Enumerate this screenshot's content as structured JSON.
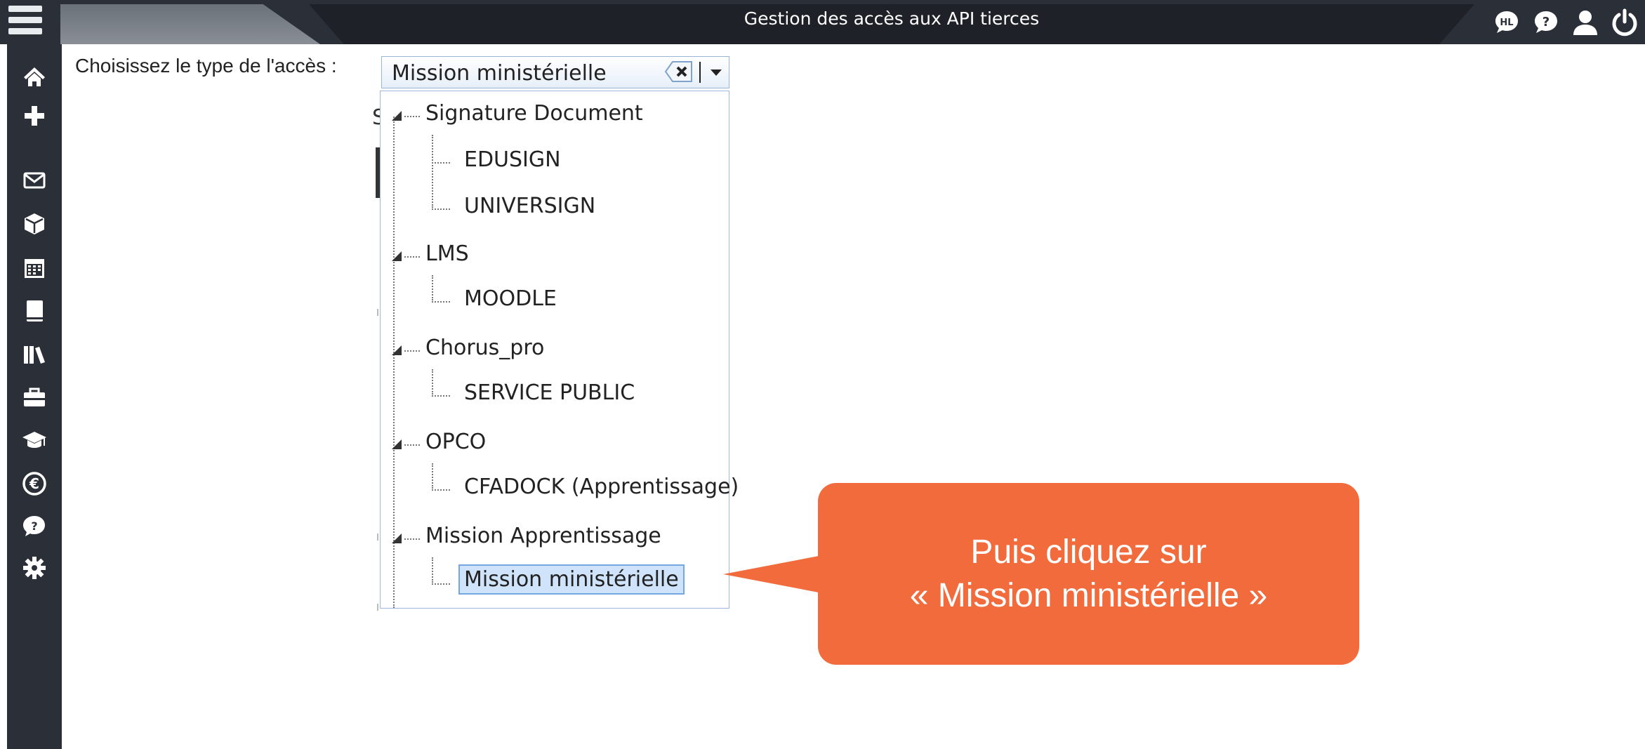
{
  "window": {
    "title": "Gestion des accès aux API tierces"
  },
  "top_icons": [
    "hl-chat-icon",
    "help-chat-icon",
    "user-icon",
    "power-icon"
  ],
  "sidebar": {
    "items": [
      {
        "icon": "home-icon"
      },
      {
        "icon": "plus-icon"
      },
      {
        "icon": "envelope-icon"
      },
      {
        "icon": "cube-icon"
      },
      {
        "icon": "calendar-icon"
      },
      {
        "icon": "book-icon"
      },
      {
        "icon": "library-icon"
      },
      {
        "icon": "briefcase-icon"
      },
      {
        "icon": "graduation-cap-icon"
      },
      {
        "icon": "euro-icon"
      },
      {
        "icon": "help-bubble-icon"
      },
      {
        "icon": "gear-icon"
      }
    ]
  },
  "form": {
    "label": "Choisissez le type de l'accès :",
    "selected_value": "Mission ministérielle",
    "behind_letter": "S"
  },
  "tree": [
    {
      "label": "Signature Document",
      "children": [
        "EDUSIGN",
        "UNIVERSIGN"
      ]
    },
    {
      "label": "LMS",
      "children": [
        "MOODLE"
      ]
    },
    {
      "label": "Chorus_pro",
      "children": [
        "SERVICE PUBLIC"
      ]
    },
    {
      "label": "OPCO",
      "children": [
        "CFADOCK (Apprentissage)"
      ]
    },
    {
      "label": "Mission Apprentissage",
      "children": [
        "Mission ministérielle"
      ]
    }
  ],
  "callout": {
    "line1": "Puis cliquez sur",
    "line2": "« Mission ministérielle »"
  },
  "colors": {
    "topbar": "#2b3038",
    "callout": "#f26b3d",
    "selection": "#cfe3fb"
  }
}
